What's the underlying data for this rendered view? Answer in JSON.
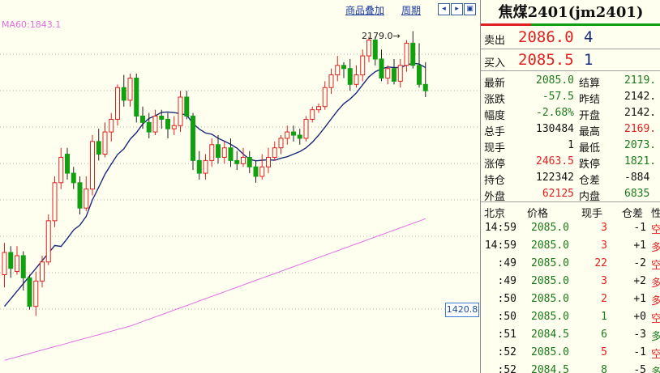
{
  "menu": {
    "compare_label": "商品叠加",
    "period_label": "周期",
    "btn_left": "◂",
    "btn_right": "▸",
    "btn_expand": "▣"
  },
  "indicator": {
    "ma_label": "MA60:1843.1"
  },
  "annotations": {
    "high_label": "2179.0→",
    "price_tag": "1420.8"
  },
  "colors": {
    "up": "#e02020",
    "down": "#10a010",
    "ma_short": "#1a2a7a",
    "ma60": "#e070e0",
    "grid": "#b0b0b0"
  },
  "candles": [
    {
      "o": 1795,
      "c": 1830,
      "h": 1845,
      "l": 1775
    },
    {
      "o": 1830,
      "c": 1805,
      "h": 1840,
      "l": 1790
    },
    {
      "o": 1800,
      "c": 1825,
      "h": 1840,
      "l": 1795
    },
    {
      "o": 1825,
      "c": 1790,
      "h": 1832,
      "l": 1770
    },
    {
      "o": 1790,
      "c": 1745,
      "h": 1795,
      "l": 1740
    },
    {
      "o": 1745,
      "c": 1785,
      "h": 1800,
      "l": 1730
    },
    {
      "o": 1785,
      "c": 1815,
      "h": 1825,
      "l": 1775
    },
    {
      "o": 1815,
      "c": 1880,
      "h": 1890,
      "l": 1810
    },
    {
      "o": 1880,
      "c": 1940,
      "h": 1950,
      "l": 1870
    },
    {
      "o": 1940,
      "c": 1980,
      "h": 1995,
      "l": 1930
    },
    {
      "o": 1985,
      "c": 1955,
      "h": 1995,
      "l": 1945
    },
    {
      "o": 1955,
      "c": 1940,
      "h": 1965,
      "l": 1930
    },
    {
      "o": 1940,
      "c": 1900,
      "h": 1950,
      "l": 1890
    },
    {
      "o": 1900,
      "c": 1930,
      "h": 1950,
      "l": 1895
    },
    {
      "o": 1930,
      "c": 2005,
      "h": 2015,
      "l": 1920
    },
    {
      "o": 2005,
      "c": 1985,
      "h": 2025,
      "l": 1975
    },
    {
      "o": 1985,
      "c": 2020,
      "h": 2035,
      "l": 1980
    },
    {
      "o": 2020,
      "c": 2040,
      "h": 2050,
      "l": 2005
    },
    {
      "o": 2040,
      "c": 2090,
      "h": 2095,
      "l": 2030
    },
    {
      "o": 2090,
      "c": 2070,
      "h": 2110,
      "l": 2060
    },
    {
      "o": 2070,
      "c": 2105,
      "h": 2112,
      "l": 2060
    },
    {
      "o": 2105,
      "c": 2045,
      "h": 2112,
      "l": 2035
    },
    {
      "o": 2045,
      "c": 2035,
      "h": 2060,
      "l": 2025
    },
    {
      "o": 2035,
      "c": 2020,
      "h": 2050,
      "l": 2010
    },
    {
      "o": 2020,
      "c": 2045,
      "h": 2055,
      "l": 2015
    },
    {
      "o": 2045,
      "c": 2040,
      "h": 2055,
      "l": 2025
    },
    {
      "o": 2040,
      "c": 2025,
      "h": 2050,
      "l": 2010
    },
    {
      "o": 2025,
      "c": 2030,
      "h": 2045,
      "l": 2015
    },
    {
      "o": 2030,
      "c": 2075,
      "h": 2085,
      "l": 2020
    },
    {
      "o": 2075,
      "c": 2045,
      "h": 2085,
      "l": 2040
    },
    {
      "o": 2045,
      "c": 1975,
      "h": 2050,
      "l": 1960
    },
    {
      "o": 1975,
      "c": 1955,
      "h": 1990,
      "l": 1945
    },
    {
      "o": 1955,
      "c": 1975,
      "h": 1985,
      "l": 1945
    },
    {
      "o": 1975,
      "c": 2000,
      "h": 2010,
      "l": 1965
    },
    {
      "o": 2000,
      "c": 1980,
      "h": 2015,
      "l": 1970
    },
    {
      "o": 1980,
      "c": 1995,
      "h": 2005,
      "l": 1970
    },
    {
      "o": 1995,
      "c": 1975,
      "h": 2010,
      "l": 1965
    },
    {
      "o": 1975,
      "c": 1970,
      "h": 1990,
      "l": 1960
    },
    {
      "o": 1970,
      "c": 1980,
      "h": 1995,
      "l": 1965
    },
    {
      "o": 1980,
      "c": 1965,
      "h": 1990,
      "l": 1955
    },
    {
      "o": 1965,
      "c": 1950,
      "h": 1975,
      "l": 1940
    },
    {
      "o": 1950,
      "c": 1965,
      "h": 1985,
      "l": 1945
    },
    {
      "o": 1965,
      "c": 1980,
      "h": 1995,
      "l": 1955
    },
    {
      "o": 1980,
      "c": 1995,
      "h": 2005,
      "l": 1975
    },
    {
      "o": 1995,
      "c": 2010,
      "h": 2015,
      "l": 1985
    },
    {
      "o": 2010,
      "c": 2020,
      "h": 2030,
      "l": 2000
    },
    {
      "o": 2020,
      "c": 2015,
      "h": 2030,
      "l": 2005
    },
    {
      "o": 2015,
      "c": 2010,
      "h": 2025,
      "l": 2000
    },
    {
      "o": 2010,
      "c": 2040,
      "h": 2045,
      "l": 2005
    },
    {
      "o": 2040,
      "c": 2055,
      "h": 2060,
      "l": 2035
    },
    {
      "o": 2055,
      "c": 2060,
      "h": 2065,
      "l": 2050
    },
    {
      "o": 2060,
      "c": 2090,
      "h": 2100,
      "l": 2055
    },
    {
      "o": 2090,
      "c": 2110,
      "h": 2120,
      "l": 2080
    },
    {
      "o": 2110,
      "c": 2125,
      "h": 2140,
      "l": 2100
    },
    {
      "o": 2125,
      "c": 2120,
      "h": 2130,
      "l": 2105
    },
    {
      "o": 2120,
      "c": 2095,
      "h": 2135,
      "l": 2085
    },
    {
      "o": 2095,
      "c": 2110,
      "h": 2125,
      "l": 2090
    },
    {
      "o": 2110,
      "c": 2140,
      "h": 2150,
      "l": 2100
    },
    {
      "o": 2140,
      "c": 2165,
      "h": 2170,
      "l": 2130
    },
    {
      "o": 2165,
      "c": 2135,
      "h": 2170,
      "l": 2125
    },
    {
      "o": 2135,
      "c": 2105,
      "h": 2150,
      "l": 2100
    },
    {
      "o": 2105,
      "c": 2120,
      "h": 2125,
      "l": 2095
    },
    {
      "o": 2120,
      "c": 2100,
      "h": 2135,
      "l": 2095
    },
    {
      "o": 2100,
      "c": 2125,
      "h": 2135,
      "l": 2090
    },
    {
      "o": 2125,
      "c": 2160,
      "h": 2165,
      "l": 2115
    },
    {
      "o": 2160,
      "c": 2125,
      "h": 2179,
      "l": 2120
    },
    {
      "o": 2125,
      "c": 2095,
      "h": 2160,
      "l": 2090
    },
    {
      "o": 2095,
      "c": 2085,
      "h": 2130,
      "l": 2075
    }
  ],
  "quote": {
    "title": "焦煤2401(jm2401)",
    "ask_label": "卖出",
    "ask_price": "2086.0",
    "ask_vol": "4",
    "bid_label": "买入",
    "bid_price": "2085.5",
    "bid_vol": "1",
    "stats": [
      {
        "l1": "最新",
        "v1": "2085.0",
        "c1": "green",
        "l2": "结算",
        "v2": "2119.",
        "c2": "green"
      },
      {
        "l1": "涨跌",
        "v1": "-57.5",
        "c1": "green",
        "l2": "昨结",
        "v2": "2142.",
        "c2": "blk"
      },
      {
        "l1": "幅度",
        "v1": "-2.68%",
        "c1": "green",
        "l2": "开盘",
        "v2": "2142.",
        "c2": "blk"
      },
      {
        "l1": "总手",
        "v1": "130484",
        "c1": "blk",
        "l2": "最高",
        "v2": "2169.",
        "c2": "red"
      },
      {
        "l1": "现手",
        "v1": "1",
        "c1": "blk",
        "l2": "最低",
        "v2": "2073.",
        "c2": "green"
      },
      {
        "l1": "涨停",
        "v1": "2463.5",
        "c1": "red",
        "l2": "跌停",
        "v2": "1821.",
        "c2": "green"
      },
      {
        "l1": "持仓",
        "v1": "122342",
        "c1": "blk",
        "l2": "仓差",
        "v2": "-884",
        "c2": "blk"
      },
      {
        "l1": "外盘",
        "v1": "62125",
        "c1": "red",
        "l2": "内盘",
        "v2": "6835",
        "c2": "green"
      }
    ],
    "tick_header": {
      "time": "北京",
      "price": "价格",
      "vol": "现手",
      "oi": "仓差",
      "nat": "性"
    },
    "ticks": [
      {
        "time": "14:59",
        "price": "2085.0",
        "vol": "3",
        "vc": "red",
        "oi": "-1",
        "nat": "空",
        "nc": "red"
      },
      {
        "time": "14:59",
        "price": "2085.0",
        "vol": "3",
        "vc": "red",
        "oi": "+1",
        "nat": "多",
        "nc": "red"
      },
      {
        "time": ":49",
        "price": "2085.0",
        "vol": "22",
        "vc": "red",
        "oi": "-2",
        "nat": "空",
        "nc": "red"
      },
      {
        "time": ":49",
        "price": "2085.0",
        "vol": "3",
        "vc": "red",
        "oi": "+2",
        "nat": "多",
        "nc": "red"
      },
      {
        "time": ":50",
        "price": "2085.0",
        "vol": "2",
        "vc": "red",
        "oi": "+1",
        "nat": "多",
        "nc": "red"
      },
      {
        "time": ":50",
        "price": "2085.0",
        "vol": "1",
        "vc": "green",
        "oi": "+0",
        "nat": "空",
        "nc": "red"
      },
      {
        "time": ":51",
        "price": "2084.5",
        "vol": "6",
        "vc": "green",
        "oi": "-3",
        "nat": "多",
        "nc": "green"
      },
      {
        "time": ":52",
        "price": "2085.0",
        "vol": "5",
        "vc": "red",
        "oi": "-1",
        "nat": "空",
        "nc": "red"
      },
      {
        "time": ":52",
        "price": "2084.5",
        "vol": "8",
        "vc": "green",
        "oi": "-5",
        "nat": "多",
        "nc": "green"
      }
    ]
  }
}
